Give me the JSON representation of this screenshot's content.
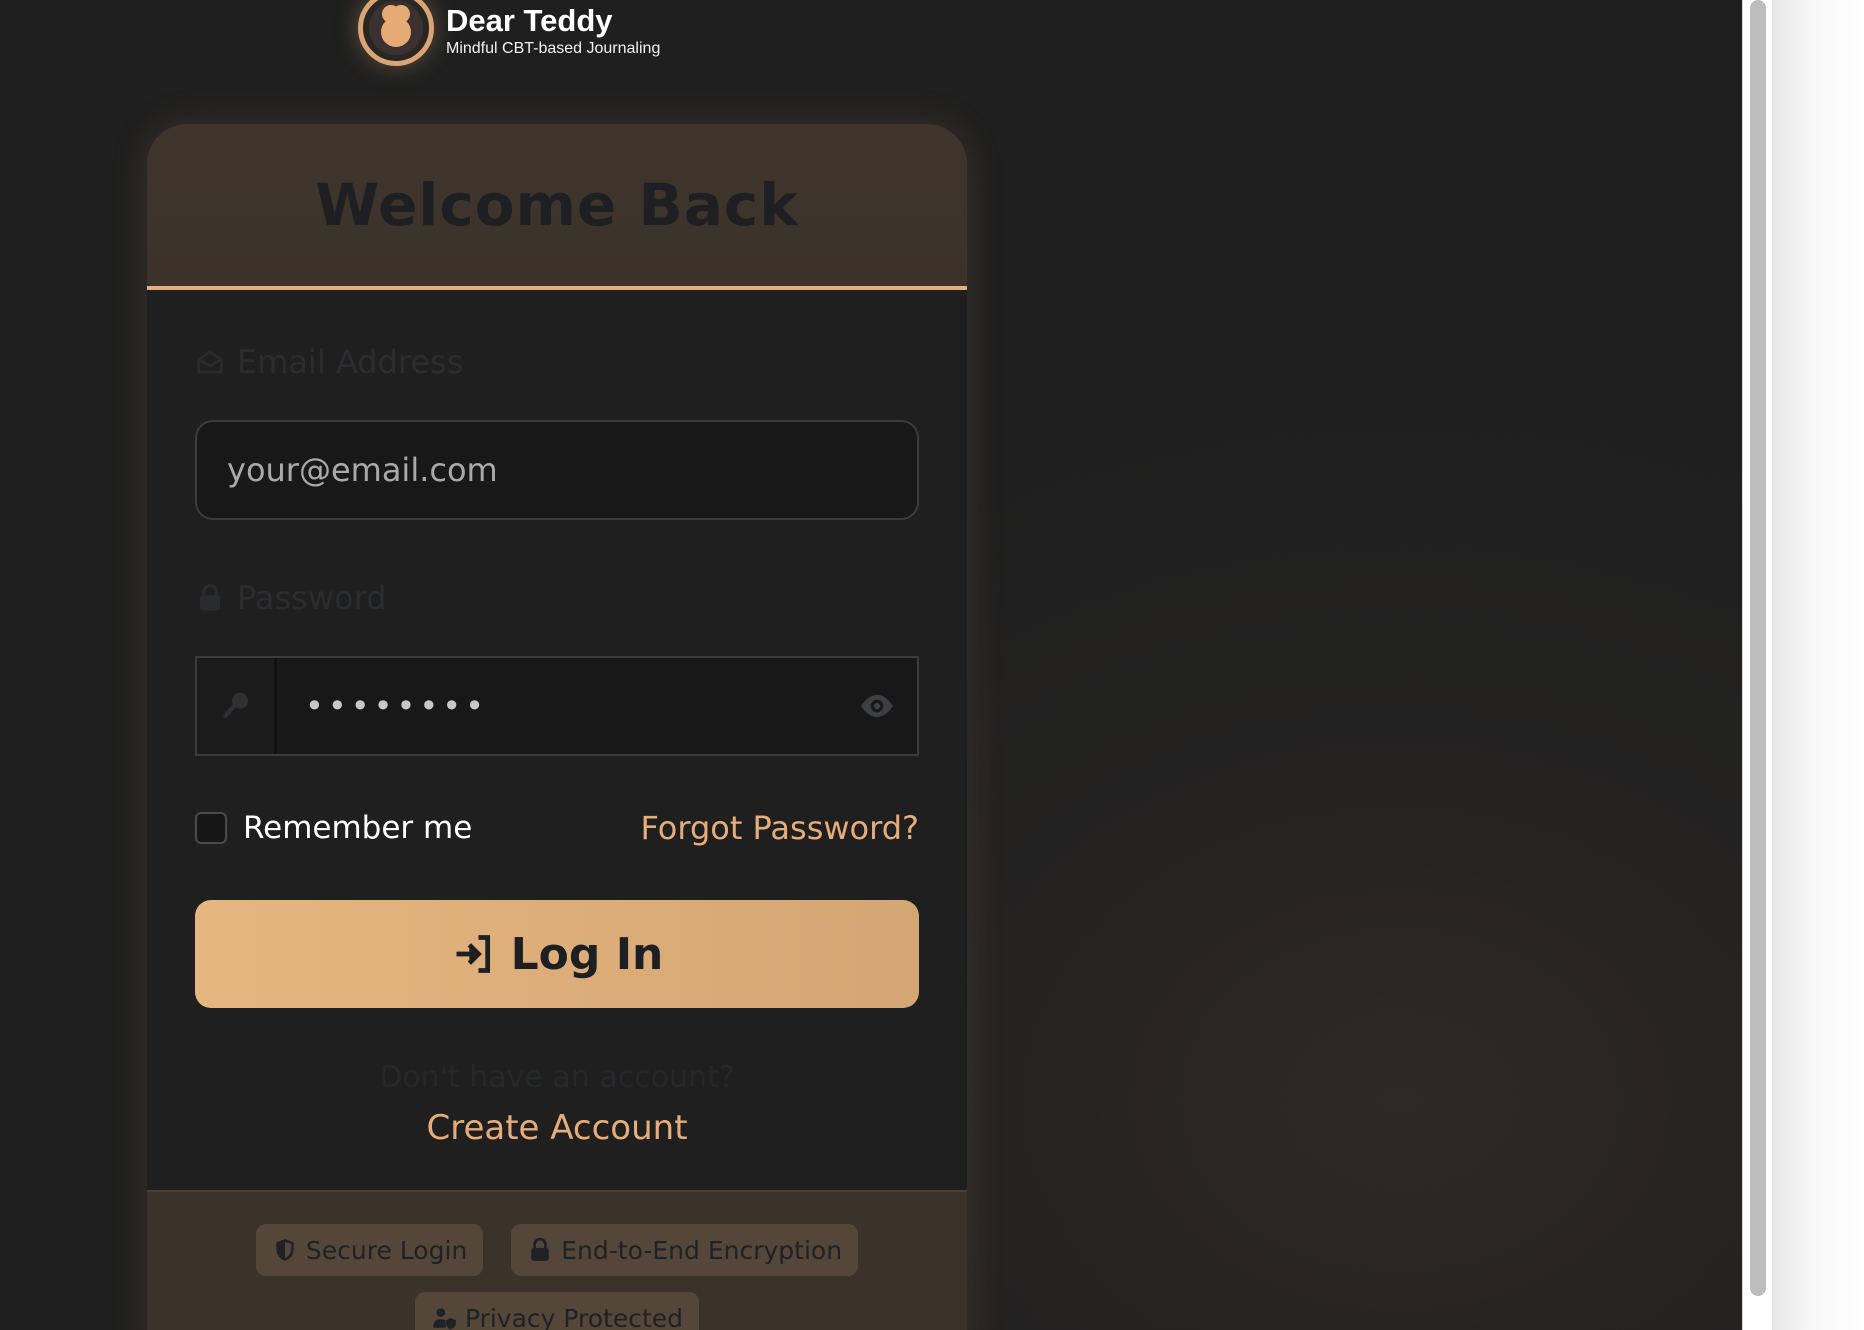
{
  "brand": {
    "name": "Dear Teddy",
    "tagline": "Mindful CBT-based Journaling",
    "logo_icon": "teddy-bear-logo"
  },
  "card": {
    "title": "Welcome Back",
    "email": {
      "label": "Email Address",
      "icon": "envelope-open-icon",
      "placeholder": "your@email.com",
      "value": ""
    },
    "password": {
      "label": "Password",
      "icon": "lock-icon",
      "prefix_icon": "key-icon",
      "masked_value": "••••••••",
      "toggle_icon": "eye-icon"
    },
    "remember_me": {
      "label": "Remember me",
      "checked": false
    },
    "forgot_password": "Forgot Password?",
    "login_button": {
      "label": "Log In",
      "icon": "sign-in-icon"
    },
    "signup_prompt": "Don't have an account?",
    "create_account": "Create Account"
  },
  "footer_badges": [
    {
      "label": "Secure Login",
      "icon": "shield-icon"
    },
    {
      "label": "End-to-End Encryption",
      "icon": "lock-icon"
    },
    {
      "label": "Privacy Protected",
      "icon": "user-shield-icon"
    }
  ],
  "colors": {
    "accent": "#e6ad7a",
    "button": "#e0b07f",
    "background": "#1f1f1f",
    "header": "#3b3229"
  }
}
